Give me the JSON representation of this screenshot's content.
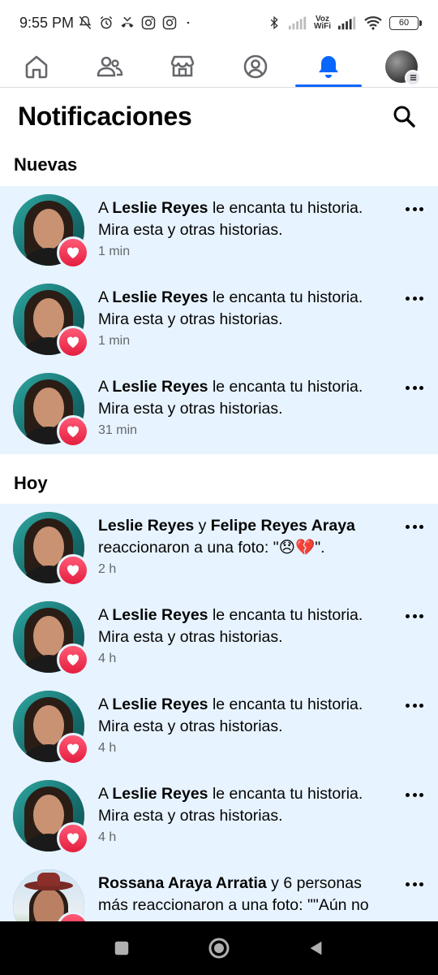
{
  "status_bar": {
    "time": "9:55 PM",
    "left_icons": [
      "mute-icon",
      "alarm-icon",
      "missed-call-icon",
      "instagram-icon",
      "instagram-icon",
      "dot"
    ],
    "volte_label": "Voz WiFi",
    "battery": "60"
  },
  "tabs": [
    {
      "name": "home",
      "icon": "home-icon"
    },
    {
      "name": "friends",
      "icon": "friends-icon"
    },
    {
      "name": "marketplace",
      "icon": "marketplace-icon"
    },
    {
      "name": "profile",
      "icon": "profile-icon"
    },
    {
      "name": "notifications",
      "icon": "bell-icon",
      "active": true
    },
    {
      "name": "menu",
      "icon": "avatar-menu-icon"
    }
  ],
  "header": {
    "title": "Notificaciones"
  },
  "sections": {
    "new_title": "Nuevas",
    "today_title": "Hoy"
  },
  "new_notifications": [
    {
      "prefix": "A ",
      "actor": "Leslie Reyes",
      "text": " le encanta tu historia. Mira esta y otras historias.",
      "time": "1 min"
    },
    {
      "prefix": "A ",
      "actor": "Leslie Reyes",
      "text": " le encanta tu historia. Mira esta y otras historias.",
      "time": "1 min"
    },
    {
      "prefix": "A ",
      "actor": "Leslie Reyes",
      "text": " le encanta tu historia. Mira esta y otras historias.",
      "time": "31 min"
    }
  ],
  "today_notifications": [
    {
      "actor": "Leslie Reyes",
      "joiner": " y ",
      "actor2": "Felipe Reyes Araya",
      "text": " reaccionaron a una foto: \"😞💔\".",
      "time": "2 h"
    },
    {
      "prefix": "A ",
      "actor": "Leslie Reyes",
      "text": " le encanta tu historia. Mira esta y otras historias.",
      "time": "4 h"
    },
    {
      "prefix": "A ",
      "actor": "Leslie Reyes",
      "text": " le encanta tu historia. Mira esta y otras historias.",
      "time": "4 h"
    },
    {
      "prefix": "A ",
      "actor": "Leslie Reyes",
      "text": " le encanta tu historia. Mira esta y otras historias.",
      "time": "4 h"
    },
    {
      "actor": "Rossana Araya Arratia",
      "text": " y 6 personas más reaccionaron a una foto: \"\"Aún no",
      "time": ""
    }
  ],
  "colors": {
    "accent": "#0866ff",
    "unread_bg": "#e7f3ff",
    "heart": "#e41e3f",
    "secondary_text": "#65676b"
  }
}
